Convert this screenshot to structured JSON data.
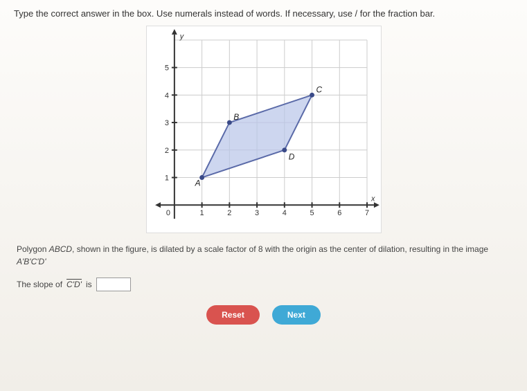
{
  "instruction": "Type the correct answer in the box. Use numerals instead of words. If necessary, use / for the fraction bar.",
  "question_prefix": "Polygon ",
  "question_poly": "ABCD",
  "question_mid": ", shown in the figure, is dilated by a scale factor of 8 with the origin as the center of dilation, resulting in the image ",
  "question_image": "A'B'C'D'",
  "answer_prefix": "The slope of ",
  "answer_segment": "C'D'",
  "answer_suffix": " is",
  "buttons": {
    "reset": "Reset",
    "next": "Next"
  },
  "chart_data": {
    "type": "coordinate-plane",
    "title": "",
    "xlabel": "x",
    "ylabel": "y",
    "xlim": [
      0,
      7
    ],
    "ylim": [
      0,
      6
    ],
    "xticks": [
      0,
      1,
      2,
      3,
      4,
      5,
      6,
      7
    ],
    "yticks": [
      0,
      1,
      2,
      3,
      4,
      5
    ],
    "points": {
      "A": {
        "x": 1,
        "y": 1
      },
      "B": {
        "x": 2,
        "y": 3
      },
      "C": {
        "x": 5,
        "y": 4
      },
      "D": {
        "x": 4,
        "y": 2
      }
    },
    "polygon": [
      "A",
      "B",
      "C",
      "D"
    ],
    "fill": "#b8c4e8",
    "stroke": "#5a6aa8"
  }
}
